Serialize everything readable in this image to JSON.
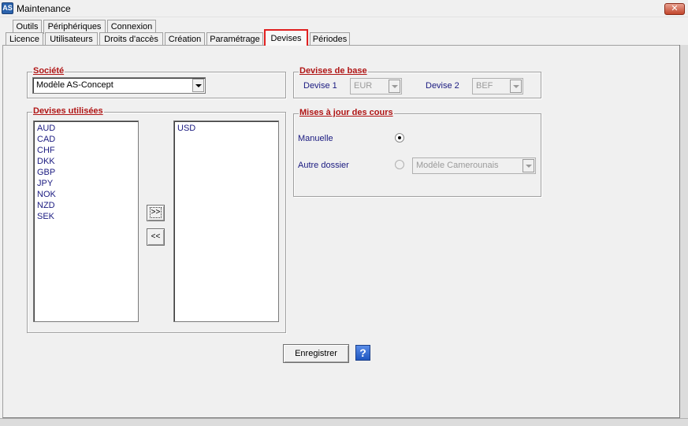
{
  "window": {
    "title": "Maintenance",
    "app_icon": "app-logo-icon",
    "close": "✕"
  },
  "tabs_top": [
    "Outils",
    "Périphériques",
    "Connexion"
  ],
  "tabs_bottom": [
    "Licence",
    "Utilisateurs",
    "Droits d'accès",
    "Création",
    "Paramétrage",
    "Devises",
    "Périodes"
  ],
  "selected_tab": "Devises",
  "societe": {
    "title": "Société",
    "value": "Modèle AS-Concept"
  },
  "devises_base": {
    "title": "Devises de base",
    "devise1_label": "Devise 1",
    "devise1_value": "EUR",
    "devise2_label": "Devise 2",
    "devise2_value": "BEF"
  },
  "devises_utilisees": {
    "title": "Devises utilisées",
    "available": [
      "AUD",
      "CAD",
      "CHF",
      "DKK",
      "GBP",
      "JPY",
      "NOK",
      "NZD",
      "SEK"
    ],
    "selected": [
      "USD"
    ],
    "add_label": ">>",
    "remove_label": "<<"
  },
  "mises_a_jour": {
    "title": "Mises à jour des cours",
    "manuelle_label": "Manuelle",
    "autre_label": "Autre dossier",
    "autre_value": "Modèle Camerounais",
    "selected_option": "Manuelle"
  },
  "footer": {
    "save_label": "Enregistrer",
    "help_label": "?"
  },
  "colors": {
    "group_title": "#b01515",
    "label": "#1a1a80",
    "selected_tab_border": "#e02020",
    "help": "#2b63d0"
  }
}
